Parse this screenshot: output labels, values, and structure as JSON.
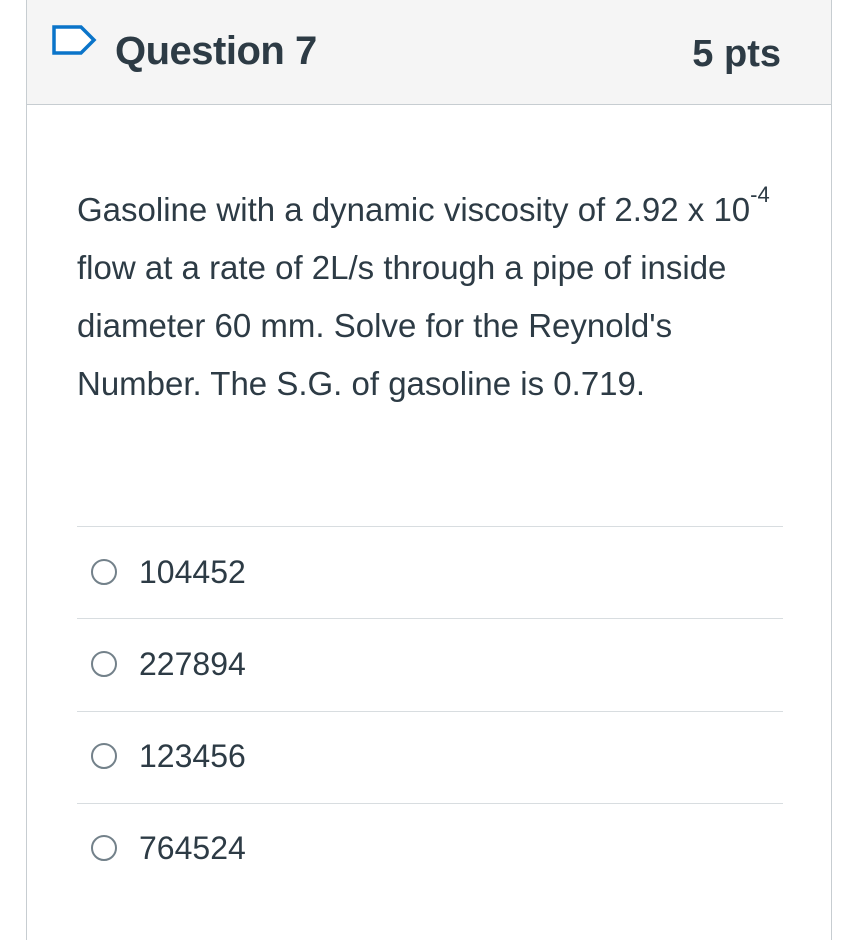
{
  "question": {
    "title": "Question 7",
    "points": "5 pts",
    "text_part1": "Gasoline with a dynamic viscosity of 2.92 x 10",
    "exponent": "-4",
    "text_part2": " flow at a rate of 2L/s through a pipe of inside diameter 60 mm. Solve for the Reynold's Number. The S.G. of gasoline is 0.719."
  },
  "answers": [
    {
      "label": "104452",
      "selected": false
    },
    {
      "label": "227894",
      "selected": false
    },
    {
      "label": "123456",
      "selected": false
    },
    {
      "label": "764524",
      "selected": false
    }
  ],
  "icons": {
    "flag": "flag-question-icon",
    "radio": "radio-button-icon"
  }
}
